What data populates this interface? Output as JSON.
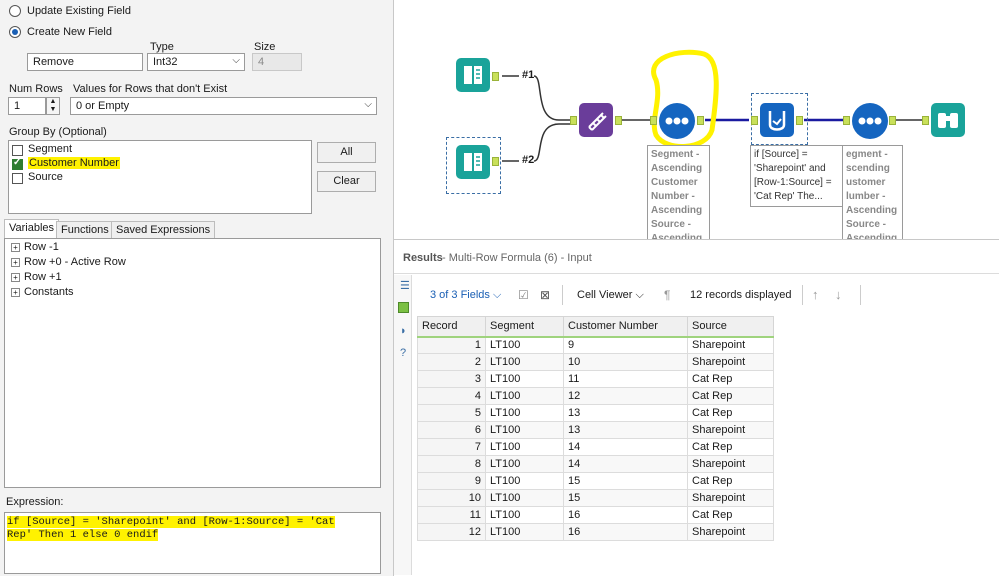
{
  "config": {
    "radio_update": "Update Existing Field",
    "radio_create": "Create New  Field",
    "type_label": "Type",
    "size_label": "Size",
    "field_name": "Remove",
    "type_value": "Int32",
    "size_value": "4",
    "num_rows_label": "Num Rows",
    "num_rows_value": "1",
    "values_label": "Values for Rows that don't Exist",
    "values_value": "0 or Empty",
    "group_by_label": "Group By (Optional)",
    "group_items": [
      {
        "label": "Segment",
        "checked": false
      },
      {
        "label": "Customer Number",
        "checked": true
      },
      {
        "label": "Source",
        "checked": false
      }
    ],
    "all_button": "All",
    "clear_button": "Clear",
    "tabs": [
      "Variables",
      "Functions",
      "Saved Expressions"
    ],
    "tree": [
      "Row -1",
      "Row +0 - Active Row",
      "Row +1",
      "Constants"
    ],
    "expression_label": "Expression:",
    "expression_line1": "if [Source] = 'Sharepoint' and [Row-1:Source] = 'Cat",
    "expression_line2": "Rep' Then 1 else 0 endif"
  },
  "canvas": {
    "conn1": "#1",
    "conn2": "#2",
    "note_sort1": "Segment -\nAscending\nCustomer\nNumber -\nAscending\nSource -\nAscending",
    "note_formula": "if [Source] =\n'Sharepoint' and\n[Row-1:Source] =\n'Cat Rep' The...",
    "note_sort2": "egment -\nscending\nustomer\nlumber -\nAscending\nSource -\nAscending"
  },
  "results": {
    "title": "Results",
    "subtitle": " - Multi-Row Formula (6) - Input",
    "fields": "3 of 3 Fields",
    "cell_viewer": "Cell Viewer",
    "records": "12 records displayed",
    "columns": [
      "Record",
      "Segment",
      "Customer Number",
      "Source"
    ],
    "rows": [
      [
        "1",
        "LT100",
        "9",
        "Sharepoint"
      ],
      [
        "2",
        "LT100",
        "10",
        "Sharepoint"
      ],
      [
        "3",
        "LT100",
        "11",
        "Cat Rep"
      ],
      [
        "4",
        "LT100",
        "12",
        "Cat Rep"
      ],
      [
        "5",
        "LT100",
        "13",
        "Cat Rep"
      ],
      [
        "6",
        "LT100",
        "13",
        "Sharepoint"
      ],
      [
        "7",
        "LT100",
        "14",
        "Cat Rep"
      ],
      [
        "8",
        "LT100",
        "14",
        "Sharepoint"
      ],
      [
        "9",
        "LT100",
        "15",
        "Cat Rep"
      ],
      [
        "10",
        "LT100",
        "15",
        "Sharepoint"
      ],
      [
        "11",
        "LT100",
        "16",
        "Cat Rep"
      ],
      [
        "12",
        "LT100",
        "16",
        "Sharepoint"
      ]
    ]
  },
  "colors": {
    "highlight": "#fff200",
    "input_tool": "#1aa39a",
    "sort_tool": "#6a3d9a",
    "formula_tool": "#1565c0",
    "browse_tool": "#1aa39a"
  }
}
